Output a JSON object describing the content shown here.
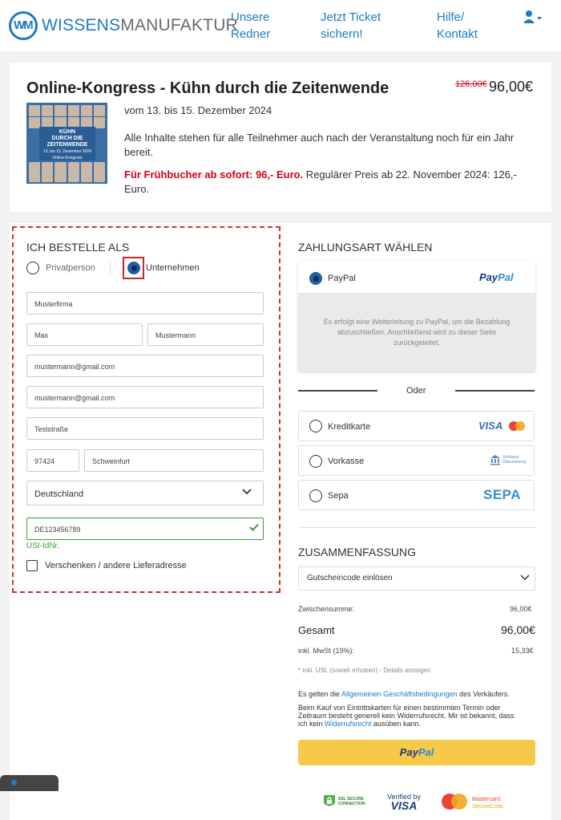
{
  "header": {
    "logo_mark": "WM",
    "logo_bold": "WISSENS",
    "logo_light": "MANUFAKTUR",
    "nav": [
      {
        "line1": "Unsere",
        "line2": "Redner"
      },
      {
        "line1": "Jetzt Ticket",
        "line2": "sichern!"
      },
      {
        "line1": "Hilfe/",
        "line2": "Kontakt"
      }
    ],
    "user_icon": "user-icon"
  },
  "product": {
    "title": "Online-Kongress - Kühn durch die Zeitenwende",
    "old_price": "126,00€",
    "price": "96,00€",
    "cover_line1": "KÜHN",
    "cover_line2": "DURCH DIE",
    "cover_line3": "ZEITENWENDE",
    "cover_line4": "13. bis 15. Dezember 2024",
    "cover_line5": "Online-Kongress",
    "date": "vom 13. bis 15. Dezember 2024",
    "info_line1": "Alle Inhalte stehen für alle Teilnehmer auch nach der Veranstaltung noch für ein Jahr",
    "info_line2": "bereit.",
    "early_bold": "Für Frühbucher ab sofort: 96,- Euro.",
    "early_rest1": " Regulärer Preis ab 22. November 2024: 126,-",
    "early_rest2": "Euro."
  },
  "order": {
    "heading": "ICH BESTELLE ALS",
    "option_private": "Privatperson",
    "option_company": "Unternehmen",
    "company": "Musterfirma",
    "first_name": "Max",
    "last_name": "Mustermann",
    "email": "mustermann@gmail.com",
    "email_confirm": "mustermann@gmail.com",
    "street": "Teststraße",
    "zip": "97424",
    "city": "Schweinfurt",
    "country": "Deutschland",
    "vat_id": "DE123456789",
    "vat_label": "USt-IdNr.",
    "gift_label": "Verschenken / andere Lieferadresse"
  },
  "payment": {
    "heading": "ZAHLUNGSART WÄHLEN",
    "paypal_label": "PayPal",
    "paypal_logo_a": "Pay",
    "paypal_logo_b": "Pal",
    "paypal_info1": "Es erfolgt eine Weiterleitung zu PayPal, um die Bezahlung",
    "paypal_info2": "abzuschließen. Anschließend wird zu dieser Seite",
    "paypal_info3": "zurückgeleitet.",
    "or": "Oder",
    "card_label": "Kreditkarte",
    "card_logo": "VISA",
    "prepay_label": "Vorkasse",
    "prepay_logo1": "Vorkasse",
    "prepay_logo2": "Überweisung",
    "sepa_label": "Sepa",
    "sepa_logo": "SEPA"
  },
  "summary": {
    "heading": "ZUSAMMENFASSUNG",
    "voucher": "Gutscheincode einlösen",
    "subtotal_label": "Zwischensumme:",
    "subtotal": "96,00€",
    "total_label": "Gesamt",
    "total": "96,00€",
    "vat_label": "inkl. MwSt (19%):",
    "vat": "15,33€",
    "tax_note": "* inkl. USt. (soweit erhoben) - ",
    "tax_link": "Details anzeigen",
    "terms_pre": "Es gelten die ",
    "terms_link": "Allgemeinen Geschäftsbedingungen",
    "terms_post": " des Verkäufers.",
    "cancel1": "Beim Kauf von Eintrittskarten für einen bestimmten Termin oder",
    "cancel2": "Zeitraum besteht generell kein Widerrufsrecht. Mir ist bekannt, dass",
    "cancel3_pre": "ich kein ",
    "cancel3_link": "Widerrufsrecht",
    "cancel3_post": " ausüben kann.",
    "pay_button_a": "Pay",
    "pay_button_b": "Pal",
    "badge_ssl1": "SSL SECURE",
    "badge_ssl2": "CONNECTION",
    "badge_visa1": "Verified by",
    "badge_visa2": "VISA",
    "badge_mc1": "Mastercard.",
    "badge_mc2": "SecureCode."
  },
  "colors": {
    "accent": "#1f7bc1",
    "alert": "#d0021b",
    "ok": "#3a9a3a",
    "paypal_button": "#f7c948"
  }
}
